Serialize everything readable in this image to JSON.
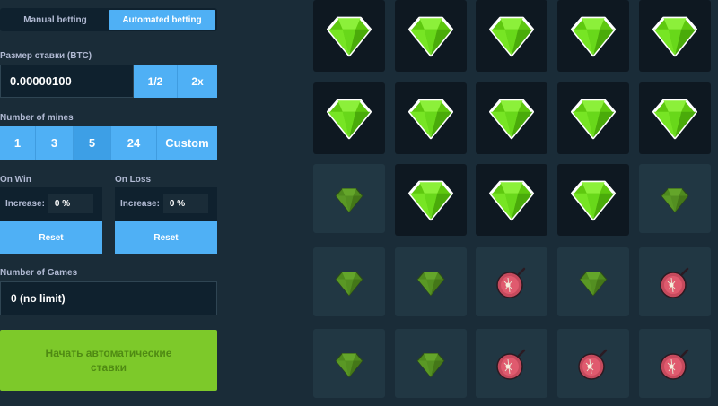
{
  "tabs": {
    "manual": "Manual betting",
    "automated": "Automated betting"
  },
  "bet": {
    "label": "Размер ставки (BTC)",
    "amount": "0.00000100",
    "half": "1/2",
    "double": "2x"
  },
  "mines": {
    "label": "Number of mines",
    "options": [
      "1",
      "3",
      "5",
      "24",
      "Custom"
    ],
    "selected": "5"
  },
  "on_win": {
    "label": "On Win",
    "increase_label": "Increase:",
    "value": "0 %",
    "reset": "Reset"
  },
  "on_loss": {
    "label": "On Loss",
    "increase_label": "Increase:",
    "value": "0 %",
    "reset": "Reset"
  },
  "games": {
    "label": "Number of Games",
    "value": "0 (no limit)"
  },
  "start_button": "Начать автоматические ставки",
  "board": {
    "rows": [
      [
        "gem",
        "gem",
        "gem",
        "gem",
        "gem"
      ],
      [
        "gem",
        "gem",
        "gem",
        "gem",
        "gem"
      ],
      [
        "gem-dim",
        "gem",
        "gem",
        "gem",
        "gem-dim"
      ],
      [
        "gem-dim",
        "gem-dim",
        "mine",
        "gem-dim",
        "mine"
      ],
      [
        "gem-dim",
        "gem-dim",
        "mine",
        "mine",
        "mine"
      ]
    ],
    "revealed_rows": [
      [
        true,
        true,
        true,
        true,
        true
      ],
      [
        true,
        true,
        true,
        true,
        true
      ],
      [
        false,
        true,
        true,
        true,
        false
      ],
      [
        false,
        false,
        false,
        false,
        false
      ],
      [
        false,
        false,
        false,
        false,
        false
      ]
    ]
  },
  "colors": {
    "accent": "#4fb0f5",
    "start": "#7dc92a",
    "gem": "#6fdc1f",
    "mine": "#e05a6e"
  }
}
